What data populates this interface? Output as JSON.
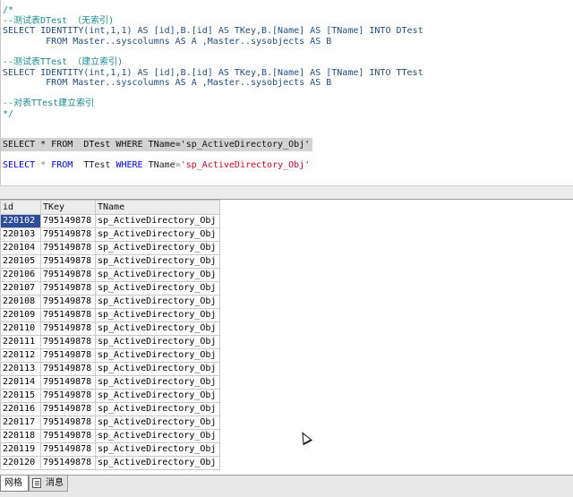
{
  "editor": {
    "lines": [
      {
        "text": "/*",
        "cls": "cm"
      },
      {
        "text": "--测试表DTest （无索引)",
        "cls": "cm"
      },
      {
        "text": "SELECT IDENTITY(int,1,1) AS [id],B.[id] AS TKey,B.[Name] AS [TName] INTO DTest",
        "cls": "sql"
      },
      {
        "text": "        FROM Master..syscolumns AS A ,Master..sysobjects AS B",
        "cls": "sql"
      },
      {
        "text": "",
        "cls": "sql"
      },
      {
        "text": "--测试表TTest （建立索引)",
        "cls": "cm"
      },
      {
        "text": "SELECT IDENTITY(int,1,1) AS [id],B.[id] AS TKey,B.[Name] AS [TName] INTO TTest",
        "cls": "sql"
      },
      {
        "text": "        FROM Master..syscolumns AS A ,Master..sysobjects AS B",
        "cls": "sql"
      },
      {
        "text": "",
        "cls": "sql"
      },
      {
        "text": "--对表TTest建立索引",
        "cls": "cm"
      },
      {
        "text": "*/",
        "cls": "cm"
      }
    ],
    "query1": "SELECT * FROM  DTest WHERE TName='sp_ActiveDirectory_Obj'",
    "query2": {
      "select": "SELECT",
      "star": " * ",
      "from": "FROM",
      "table": "  TTest ",
      "where": "WHERE",
      "col": " TName",
      "eq": "=",
      "value": "'sp_ActiveDirectory_Obj'"
    }
  },
  "grid": {
    "columns": [
      "id",
      "TKey",
      "TName"
    ],
    "rows": [
      [
        "220102",
        "795149878",
        "sp_ActiveDirectory_Obj"
      ],
      [
        "220103",
        "795149878",
        "sp_ActiveDirectory_Obj"
      ],
      [
        "220104",
        "795149878",
        "sp_ActiveDirectory_Obj"
      ],
      [
        "220105",
        "795149878",
        "sp_ActiveDirectory_Obj"
      ],
      [
        "220106",
        "795149878",
        "sp_ActiveDirectory_Obj"
      ],
      [
        "220107",
        "795149878",
        "sp_ActiveDirectory_Obj"
      ],
      [
        "220108",
        "795149878",
        "sp_ActiveDirectory_Obj"
      ],
      [
        "220109",
        "795149878",
        "sp_ActiveDirectory_Obj"
      ],
      [
        "220110",
        "795149878",
        "sp_ActiveDirectory_Obj"
      ],
      [
        "220111",
        "795149878",
        "sp_ActiveDirectory_Obj"
      ],
      [
        "220112",
        "795149878",
        "sp_ActiveDirectory_Obj"
      ],
      [
        "220113",
        "795149878",
        "sp_ActiveDirectory_Obj"
      ],
      [
        "220114",
        "795149878",
        "sp_ActiveDirectory_Obj"
      ],
      [
        "220115",
        "795149878",
        "sp_ActiveDirectory_Obj"
      ],
      [
        "220116",
        "795149878",
        "sp_ActiveDirectory_Obj"
      ],
      [
        "220117",
        "795149878",
        "sp_ActiveDirectory_Obj"
      ],
      [
        "220118",
        "795149878",
        "sp_ActiveDirectory_Obj"
      ],
      [
        "220119",
        "795149878",
        "sp_ActiveDirectory_Obj"
      ],
      [
        "220120",
        "795149878",
        "sp_ActiveDirectory_Obj"
      ]
    ],
    "selected_cell": "220102"
  },
  "tabs": [
    {
      "label": "网格",
      "icon": "grid-icon",
      "active": true
    },
    {
      "label": "消息",
      "icon": "message-icon",
      "active": false
    }
  ],
  "colors": {
    "keyword": "#0000ff",
    "string": "#e0002a",
    "comment": "#1a8c8c",
    "selection": "#2d4c9a"
  }
}
